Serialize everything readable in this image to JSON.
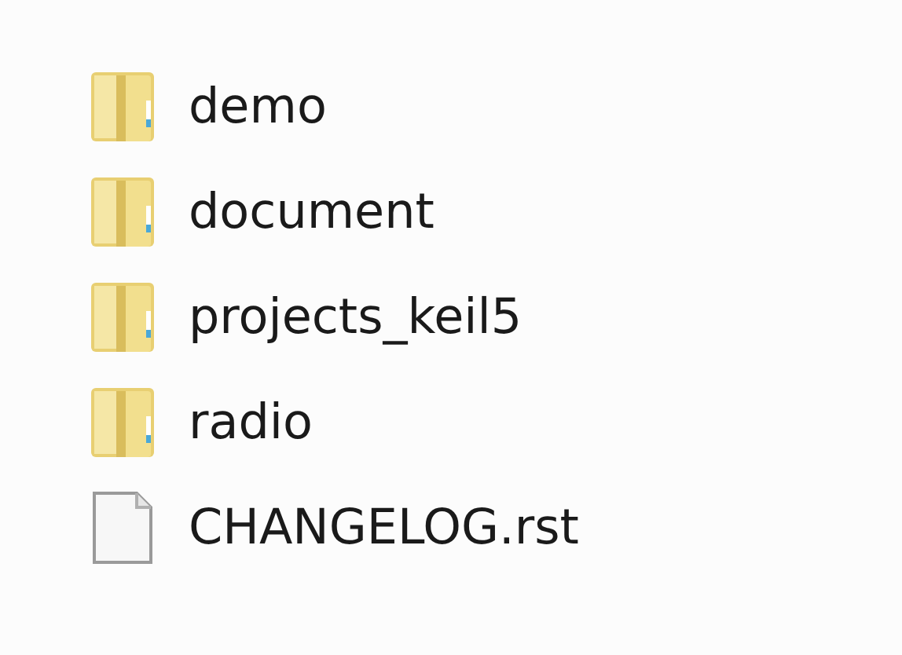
{
  "files": [
    {
      "name": "demo",
      "kind": "folder"
    },
    {
      "name": "document",
      "kind": "folder"
    },
    {
      "name": "projects_keil5",
      "kind": "folder"
    },
    {
      "name": "radio",
      "kind": "folder"
    },
    {
      "name": "CHANGELOG.rst",
      "kind": "file"
    }
  ]
}
